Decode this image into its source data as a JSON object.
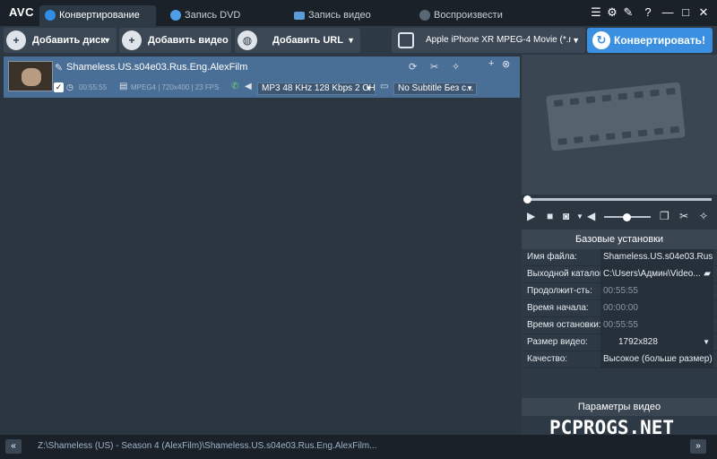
{
  "app": {
    "logo": "AVC"
  },
  "tabs": [
    {
      "label": "Конвертирование",
      "active": true
    },
    {
      "label": "Запись DVD"
    },
    {
      "label": "Запись видео"
    },
    {
      "label": "Воспроизвести"
    }
  ],
  "window_controls": {
    "help": "?",
    "minimize": "—",
    "maximize": "□",
    "close": "✕"
  },
  "toolbar": {
    "add_disc": "Добавить диск",
    "add_video": "Добавить видео",
    "add_url": "Добавить URL",
    "profile": "Apple iPhone XR MPEG-4 Movie (*.m...",
    "convert": "Конвертировать!"
  },
  "file": {
    "name": "Shameless.US.s04e03.Rus.Eng.AlexFilm",
    "duration": "00:55:55",
    "format": "MPEG4 | 720x400 | 23 FPS",
    "audio": "MP3 48 KHz 128 Kbps 2 CH",
    "subtitle": "No Subtitle Без с..."
  },
  "settings": {
    "header": "Базовые установки",
    "rows": [
      {
        "label": "Имя файла:",
        "value": "Shameless.US.s04e03.Rus.E..."
      },
      {
        "label": "Выходной каталог:",
        "value": "C:\\Users\\Админ\\Video..."
      },
      {
        "label": "Продолжит-сть:",
        "value": "00:55:55"
      },
      {
        "label": "Время начала:",
        "value": "00:00:00"
      },
      {
        "label": "Время остановки:",
        "value": "00:55:55"
      },
      {
        "label": "Размер видео:",
        "value": "1792x828"
      },
      {
        "label": "Качество:",
        "value": "Высокое (больше размер)"
      }
    ],
    "video_params": "Параметры видео"
  },
  "status": {
    "path": "Z:\\Shameless (US) - Season 4 (AlexFilm)\\Shameless.US.s04e03.Rus.Eng.AlexFilm...",
    "prev": "«",
    "next": "»"
  },
  "watermark": "PCPROGS.NET",
  "colors": {
    "accent": "#3a8fe0",
    "selected_row": "#4a6f97",
    "background": "#2b3640"
  }
}
